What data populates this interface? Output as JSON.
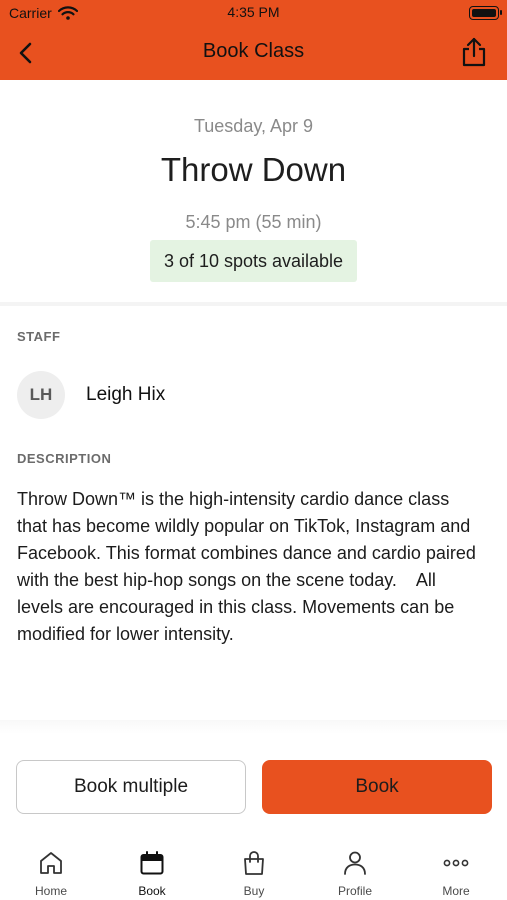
{
  "status_bar": {
    "carrier": "Carrier",
    "time": "4:35 PM"
  },
  "nav": {
    "title": "Book Class",
    "back_icon": "chevron-left-icon",
    "share_icon": "share-icon"
  },
  "colors": {
    "brand": "#e8511f",
    "spots_bg": "#e4f3e2"
  },
  "class": {
    "date": "Tuesday, Apr 9",
    "title": "Throw Down",
    "time": "5:45 pm (55 min)",
    "spots": "3 of 10 spots available"
  },
  "staff": {
    "label": "STAFF",
    "initials": "LH",
    "name": "Leigh Hix"
  },
  "description": {
    "label": "DESCRIPTION",
    "text": "Throw Down™ is the high-intensity cardio dance class that has become wildly popular on TikTok, Instagram and Facebook. This format combines dance and cardio paired with the best hip-hop songs on the scene today.    All levels are encouraged in this class. Movements can be modified for lower intensity."
  },
  "actions": {
    "book_multiple": "Book multiple",
    "book": "Book"
  },
  "tabs": [
    {
      "label": "Home",
      "icon": "home-icon"
    },
    {
      "label": "Book",
      "icon": "calendar-icon",
      "active": true
    },
    {
      "label": "Buy",
      "icon": "shopping-bag-icon"
    },
    {
      "label": "Profile",
      "icon": "person-icon"
    },
    {
      "label": "More",
      "icon": "more-dots-icon"
    }
  ]
}
